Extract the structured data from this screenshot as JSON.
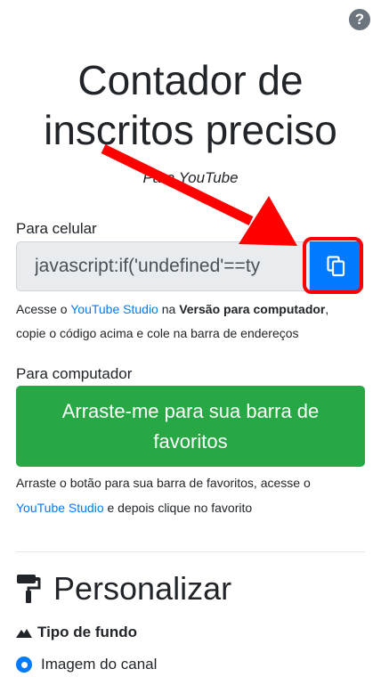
{
  "header": {
    "help_icon": "?",
    "title": "Contador de inscritos preciso",
    "subtitle": "Para YouTube"
  },
  "mobile": {
    "label": "Para celular",
    "code_value": "javascript:if('undefined'==ty",
    "copy_icon": "copy-icon",
    "help_prefix": "Acesse o ",
    "help_link": "YouTube Studio",
    "help_middle": " na ",
    "help_bold": "Versão para computador",
    "help_suffix": ",",
    "help_line2": "copie o código acima e cole na barra de endereços"
  },
  "desktop": {
    "label": "Para computador",
    "button_label": "Arraste-me para sua barra de favoritos",
    "help_line1": "Arraste o botão para sua barra de favoritos, acesse o",
    "help_link": "YouTube Studio",
    "help_line2_suffix": " e depois clique no favorito"
  },
  "customize": {
    "icon": "paint-roller-icon",
    "heading": "Personalizar",
    "background_type_icon": "mountain-icon",
    "background_type_label": "Tipo de fundo",
    "option_selected": "Imagem do canal"
  },
  "colors": {
    "primary": "#007bff",
    "success": "#28a745",
    "annotation": "#ff0000"
  }
}
